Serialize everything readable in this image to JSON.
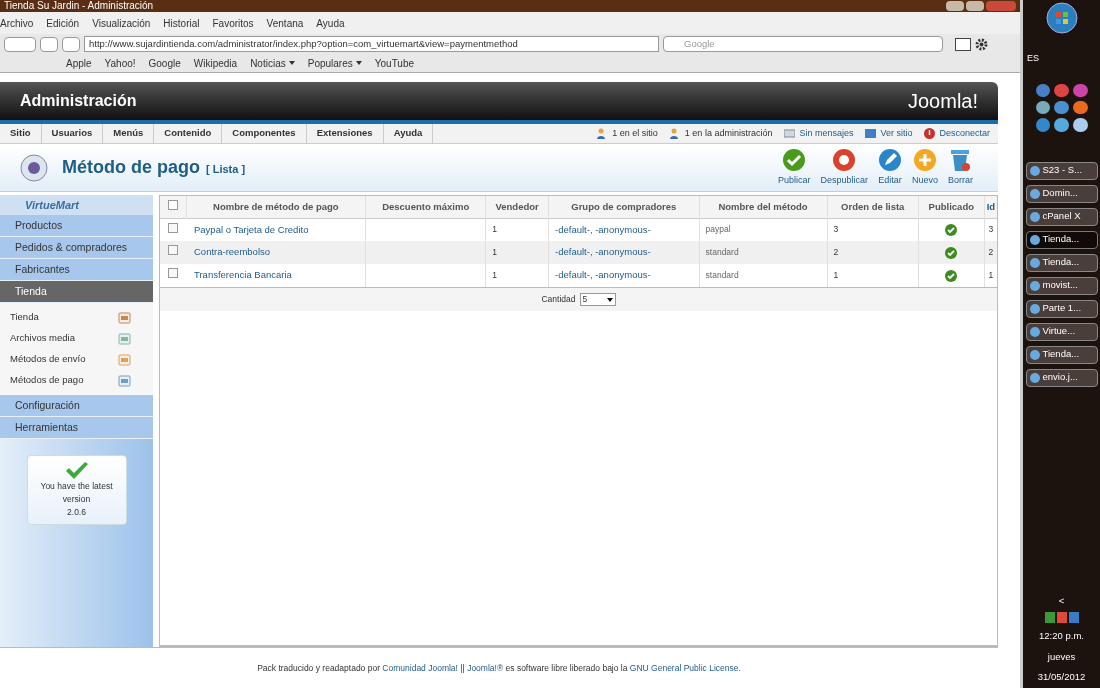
{
  "window": {
    "title": "Tienda Su Jardin - Administración"
  },
  "menu_bar": [
    "Archivo",
    "Edición",
    "Visualización",
    "Historial",
    "Favoritos",
    "Ventana",
    "Ayuda"
  ],
  "address_bar": {
    "value": "http://www.sujardintienda.com/administrator/index.php?option=com_virtuemart&view=paymentmethod"
  },
  "search": {
    "placeholder": "Google"
  },
  "bookmarks": [
    {
      "label": "Apple",
      "kind": "link"
    },
    {
      "label": "Yahoo!",
      "kind": "link"
    },
    {
      "label": "Google",
      "kind": "link"
    },
    {
      "label": "Wikipedia",
      "kind": "link"
    },
    {
      "label": "Noticias",
      "kind": "menu"
    },
    {
      "label": "Populares",
      "kind": "menu"
    },
    {
      "label": "YouTube",
      "kind": "link"
    }
  ],
  "header": {
    "title": "Administración",
    "logo": "Joomla!"
  },
  "admin_menu": [
    "Sitio",
    "Usuarios",
    "Menús",
    "Contenido",
    "Componentes",
    "Extensiones",
    "Ayuda"
  ],
  "status_links": [
    {
      "label": "1 en el sitio",
      "kind": "users"
    },
    {
      "label": "1 en la administración",
      "kind": "users"
    },
    {
      "label": "Sin mensajes",
      "kind": "mail"
    },
    {
      "label": "Ver sitio",
      "kind": "screen"
    },
    {
      "label": "Desconectar",
      "kind": "logout"
    }
  ],
  "page_title": {
    "title": "Método de pago",
    "subtitle": "[ Lista ]"
  },
  "toolbar": [
    {
      "label": "Publicar",
      "kind": "publish"
    },
    {
      "label": "Despublicar",
      "kind": "unpublish"
    },
    {
      "label": "Editar",
      "kind": "edit"
    },
    {
      "label": "Nuevo",
      "kind": "new"
    },
    {
      "label": "Borrar",
      "kind": "delete"
    }
  ],
  "sidebar": {
    "logo": "VirtueMart",
    "items": [
      {
        "label": "Productos",
        "selected": false
      },
      {
        "label": "Pedidos & compradores",
        "selected": false
      },
      {
        "label": "Fabricantes",
        "selected": false
      },
      {
        "label": "Tienda",
        "selected": true,
        "children": [
          {
            "label": "Tienda",
            "kind": "store"
          },
          {
            "label": "Archivos media",
            "kind": "media"
          },
          {
            "label": "Métodos de envío",
            "kind": "shipping"
          },
          {
            "label": "Métodos de pago",
            "kind": "payment"
          }
        ]
      },
      {
        "label": "Configuración",
        "selected": false
      },
      {
        "label": "Herramientas",
        "selected": false
      }
    ],
    "version_box": {
      "text": "You have the latest version",
      "version": "2.0.6"
    }
  },
  "table": {
    "select_all": {
      "checked": false
    },
    "columns": [
      "Nombre de método de pago",
      "Descuento máximo",
      "Vendedor",
      "Grupo de compradores",
      "Nombre del método",
      "Orden de lista",
      "Publicado",
      "Id"
    ],
    "rows": [
      {
        "checked": false,
        "name": "Paypal o Tarjeta de Credito",
        "vendor": "1",
        "group": "-default-, -anonymous-",
        "method": "paypal",
        "order": "3",
        "published": true,
        "id": "3"
      },
      {
        "checked": false,
        "name": "Contra-reembolso",
        "vendor": "1",
        "group": "-default-, -anonymous-",
        "method": "standard",
        "order": "2",
        "published": true,
        "id": "2"
      },
      {
        "checked": false,
        "name": "Transferencia Bancaria",
        "vendor": "1",
        "group": "-default-, -anonymous-",
        "method": "standard",
        "order": "1",
        "published": true,
        "id": "1"
      }
    ],
    "quantity": {
      "label": "Cantidad",
      "value": "5"
    }
  },
  "footer": {
    "text": "Pack traducido y readaptado por",
    "link1": "Comunidad Joomla!",
    "sep": "||",
    "link2": "Joomla!®",
    "text2": "es software libre liberado bajo la",
    "link3": "GNU General Public License."
  },
  "taskbar": {
    "language": "ES",
    "items": [
      {
        "label": "S23 - S...",
        "selected": false
      },
      {
        "label": "Domin...",
        "selected": false
      },
      {
        "label": "cPanel X",
        "selected": false
      },
      {
        "label": "Tienda...",
        "selected": true
      },
      {
        "label": "Tienda...",
        "selected": false
      },
      {
        "label": "movist...",
        "selected": false
      },
      {
        "label": "Parte 1...",
        "selected": false
      },
      {
        "label": "Virtue...",
        "selected": false
      },
      {
        "label": "Tienda...",
        "selected": false
      },
      {
        "label": "envio.j...",
        "selected": false
      }
    ],
    "collapse": "<",
    "time": "12:20 p.m.",
    "day": "jueves",
    "date": "31/05/2012"
  }
}
